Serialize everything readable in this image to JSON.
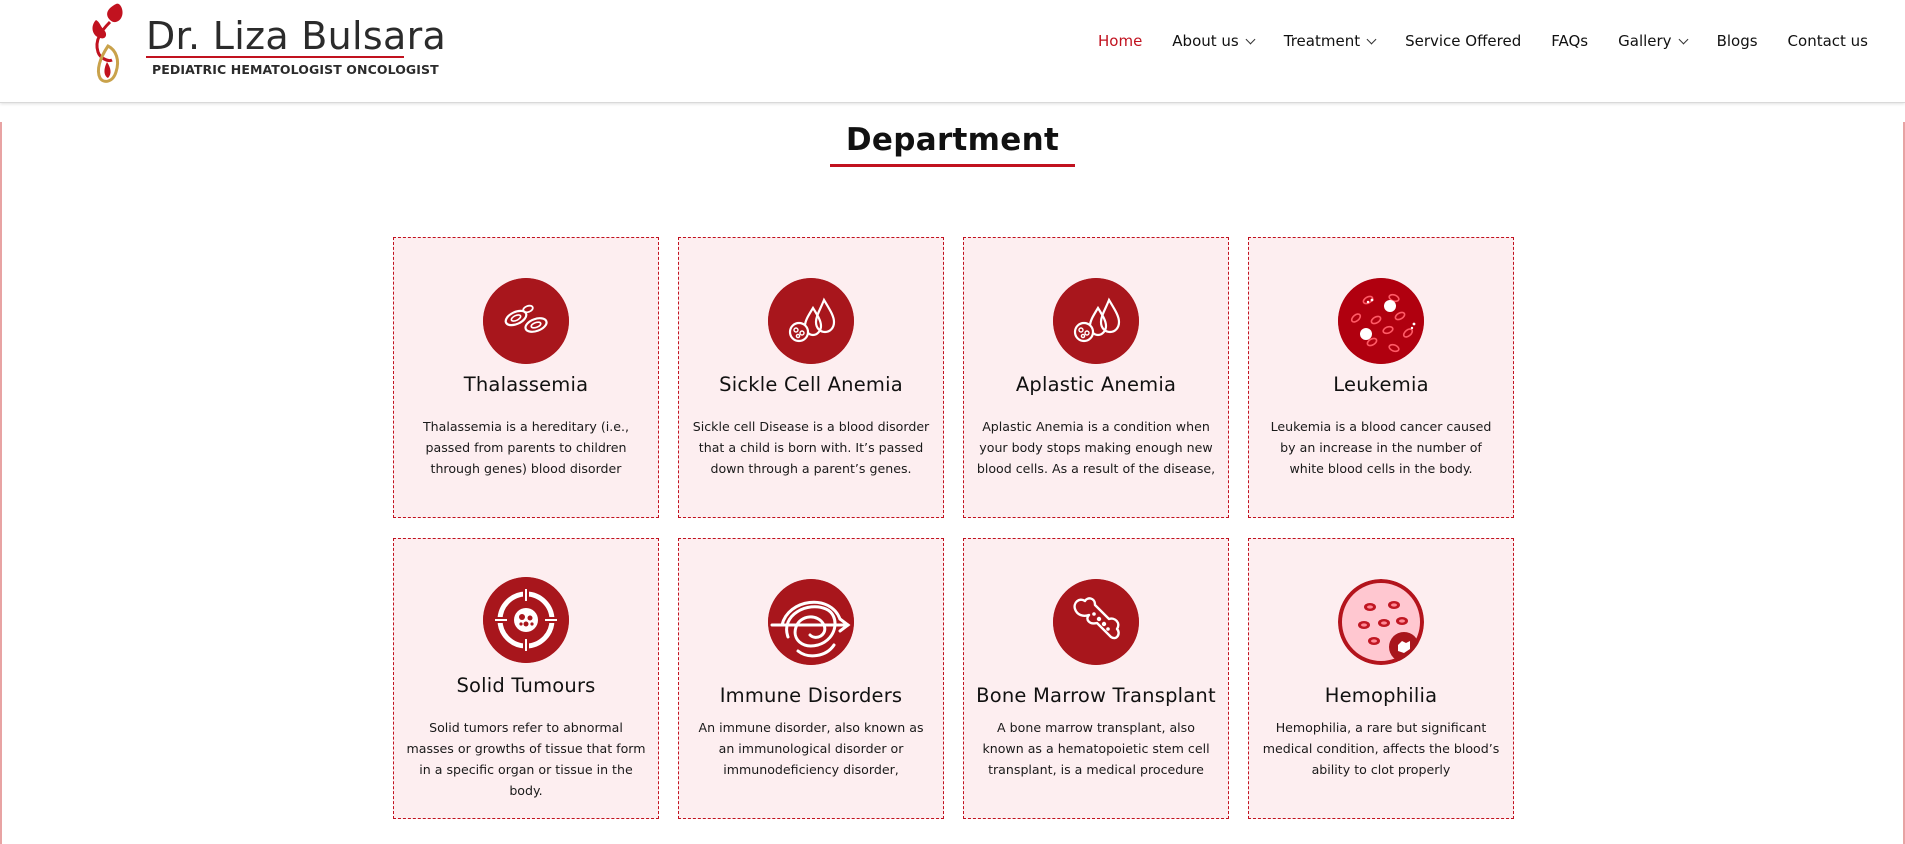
{
  "brand": {
    "name": "Dr. Liza Bulsara",
    "tagline": "PEDIATRIC HEMATOLOGIST ONCOLOGIST"
  },
  "nav": {
    "items": [
      {
        "label": "Home",
        "active": true,
        "has_dropdown": false
      },
      {
        "label": "About us",
        "active": false,
        "has_dropdown": true
      },
      {
        "label": "Treatment",
        "active": false,
        "has_dropdown": true
      },
      {
        "label": "Service Offered",
        "active": false,
        "has_dropdown": false
      },
      {
        "label": "FAQs",
        "active": false,
        "has_dropdown": false
      },
      {
        "label": "Gallery",
        "active": false,
        "has_dropdown": true
      },
      {
        "label": "Blogs",
        "active": false,
        "has_dropdown": false
      },
      {
        "label": "Contact us",
        "active": false,
        "has_dropdown": false
      }
    ]
  },
  "section": {
    "title": "Department"
  },
  "departments": [
    {
      "title": "Thalassemia",
      "icon": "red-blood-cells-icon",
      "desc": "Thalassemia is a hereditary (i.e., passed from parents to children through genes) blood disorder"
    },
    {
      "title": "Sickle Cell Anemia",
      "icon": "blood-drops-cells-icon",
      "desc": "Sickle cell Disease is a blood disorder that a child is born with. It’s passed down through a parent’s genes."
    },
    {
      "title": "Aplastic Anemia",
      "icon": "blood-drops-cells-icon",
      "desc": "Aplastic Anemia is a condition when your body stops making enough new blood cells. As a result of the disease,"
    },
    {
      "title": "Leukemia",
      "icon": "blood-cells-microscope-icon",
      "desc": "Leukemia is a blood cancer caused by an increase in the number of white blood cells in the body."
    },
    {
      "title": "Solid Tumours",
      "icon": "tumour-target-icon",
      "desc": "Solid tumors refer to abnormal masses or growths of tissue that form in a specific organ or tissue in the body."
    },
    {
      "title": "Immune Disorders",
      "icon": "immune-network-icon",
      "desc": "An immune disorder, also known as an immunological disorder or immunodeficiency disorder,"
    },
    {
      "title": "Bone Marrow Transplant",
      "icon": "bone-marrow-icon",
      "desc": "A bone marrow transplant, also known as a hematopoietic stem cell transplant, is a medical procedure"
    },
    {
      "title": "Hemophilia",
      "icon": "hemophilia-cells-icon",
      "desc": "Hemophilia, a rare but significant medical condition, affects the blood’s ability to clot properly"
    }
  ],
  "colors": {
    "accent": "#c1121f",
    "icon_bg": "#a8161c",
    "card_bg": "#fdeef0"
  }
}
